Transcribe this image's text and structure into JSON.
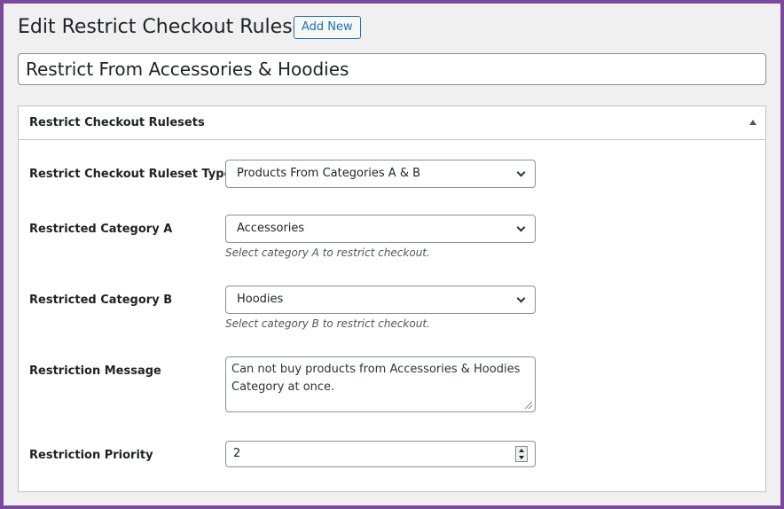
{
  "header": {
    "title": "Edit Restrict Checkout Ruleset",
    "add_new_label": "Add New"
  },
  "post_title": "Restrict From Accessories & Hoodies",
  "metabox": {
    "title": "Restrict Checkout Rulesets",
    "fields": {
      "ruleset_type": {
        "label": "Restrict Checkout Ruleset Type",
        "value": "Products From Categories A & B"
      },
      "category_a": {
        "label": "Restricted Category A",
        "value": "Accessories",
        "hint": "Select category A to restrict checkout."
      },
      "category_b": {
        "label": "Restricted Category B",
        "value": "Hoodies",
        "hint": "Select category B to restrict checkout."
      },
      "message": {
        "label": "Restriction Message",
        "value": "Can not buy products from Accessories & Hoodies Category at once."
      },
      "priority": {
        "label": "Restriction Priority",
        "value": "2"
      }
    }
  },
  "colors": {
    "frame": "#7b4a9c",
    "accent": "#2271b1",
    "background": "#f0f0f1"
  }
}
